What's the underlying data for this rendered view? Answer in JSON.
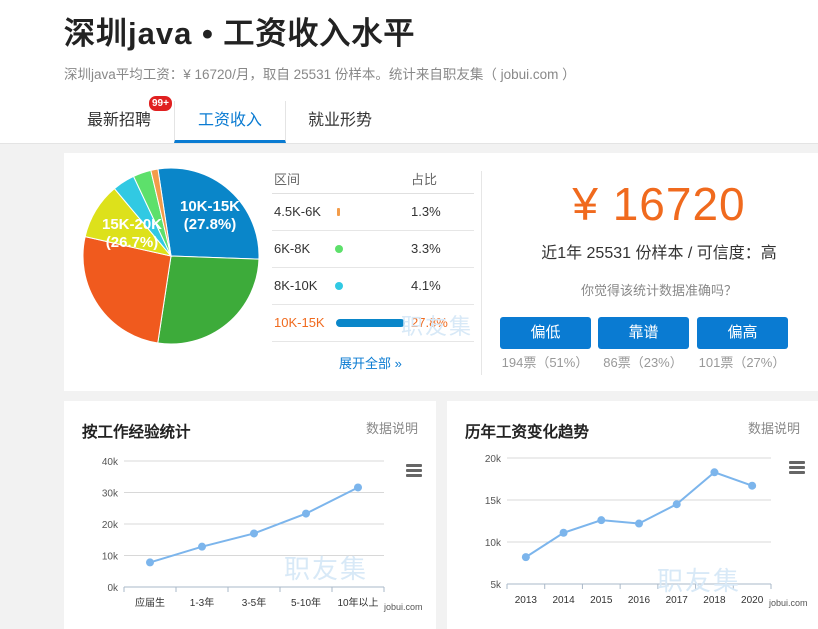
{
  "header": {
    "title": "深圳java • 工资收入水平",
    "subtitle": "深圳java平均工资：¥ 16720/月，取自 25531 份样本。统计来自职友集（ jobui.com ）",
    "tabs": [
      {
        "label": "最新招聘",
        "badge": "99+"
      },
      {
        "label": "工资收入"
      },
      {
        "label": "就业形势"
      }
    ]
  },
  "distribution": {
    "head_range": "区间",
    "head_pct": "占比",
    "rows": [
      {
        "range": "4.5K-6K",
        "pct": "1.3%",
        "value": 1.3,
        "color": "#f39c4a"
      },
      {
        "range": "6K-8K",
        "pct": "3.3%",
        "value": 3.3,
        "color": "#5de06b"
      },
      {
        "range": "8K-10K",
        "pct": "4.1%",
        "value": 4.1,
        "color": "#31c9e3"
      },
      {
        "range": "10K-15K",
        "pct": "27.8%",
        "value": 27.8,
        "color": "#0a86c9"
      }
    ],
    "expand": "展开全部 »",
    "pie_labels": [
      {
        "name": "10K-15K",
        "pct": "(27.8%)"
      },
      {
        "name": "15K-20K",
        "pct": "(26.7%)"
      }
    ]
  },
  "pie_data": {
    "slices": [
      {
        "value": 27.8,
        "color": "#0a86c9"
      },
      {
        "value": 26.7,
        "color": "#3dab3a"
      },
      {
        "value": 26.0,
        "color": "#f05a1e"
      },
      {
        "value": 10.3,
        "color": "#dde11b"
      },
      {
        "value": 4.1,
        "color": "#31c9e3"
      },
      {
        "value": 3.3,
        "color": "#5de06b"
      },
      {
        "value": 1.3,
        "color": "#f39c4a"
      }
    ]
  },
  "summary": {
    "salary": "¥ 16720",
    "sample": "近1年 25531 份样本 / 可信度：高",
    "question": "你觉得该统计数据准确吗？",
    "votes": [
      {
        "label": "偏低",
        "count": "194票（51%）"
      },
      {
        "label": "靠谱",
        "count": "86票（23%）"
      },
      {
        "label": "偏高",
        "count": "101票（27%）"
      }
    ]
  },
  "watermark": "职友集",
  "jobui": "jobui.com",
  "experience": {
    "title": "按工作经验统计",
    "note": "数据说明"
  },
  "yearly": {
    "title": "历年工资变化趋势",
    "note": "数据说明"
  },
  "chart_data": [
    {
      "type": "line",
      "title": "按工作经验统计",
      "categories": [
        "应届生",
        "1-3年",
        "3-5年",
        "5-10年",
        "10年以上"
      ],
      "values": [
        7800,
        12800,
        17000,
        23300,
        31600
      ],
      "y_ticks": [
        "0k",
        "10k",
        "20k",
        "30k",
        "40k"
      ],
      "ylim": [
        0,
        40000
      ],
      "color": "#7cb5ec"
    },
    {
      "type": "line",
      "title": "历年工资变化趋势",
      "categories": [
        "2013",
        "2014",
        "2015",
        "2016",
        "2017",
        "2018",
        "2020"
      ],
      "values": [
        8200,
        11100,
        12600,
        12200,
        14500,
        18300,
        16700
      ],
      "y_ticks": [
        "5k",
        "10k",
        "15k",
        "20k"
      ],
      "ylim": [
        5000,
        20000
      ],
      "color": "#7cb5ec"
    }
  ]
}
